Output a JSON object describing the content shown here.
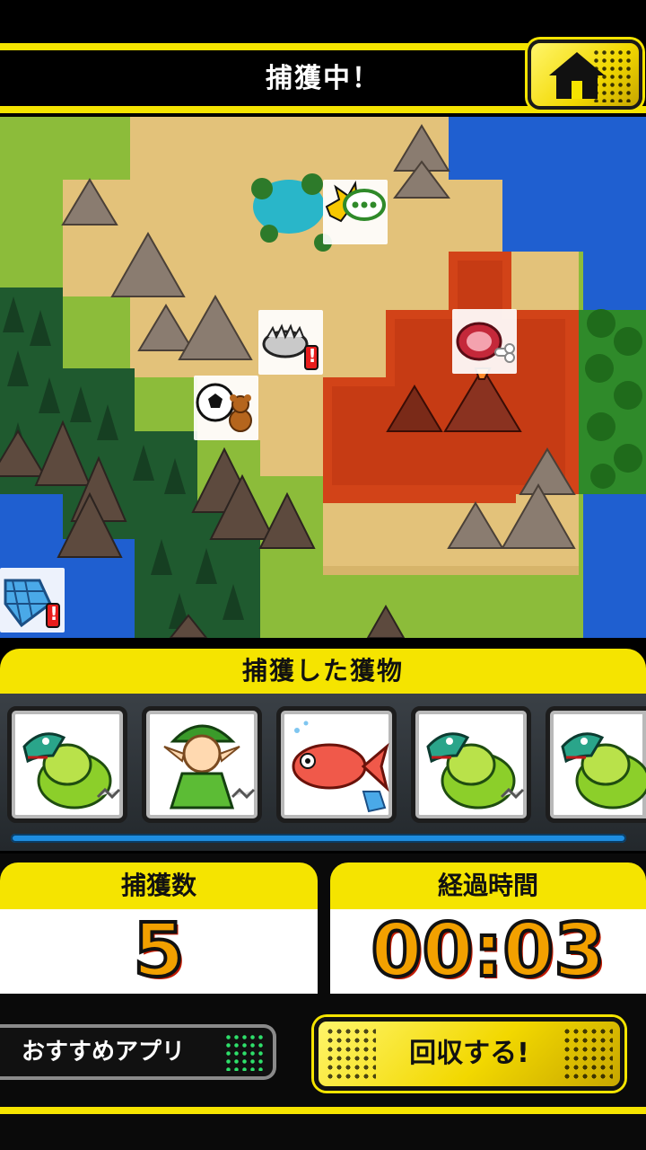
{
  "header": {
    "title": "捕獲中！"
  },
  "caught": {
    "title": "捕獲した獲物"
  },
  "stats": {
    "count_label": "捕獲数",
    "count_value": "5",
    "time_label": "経過時間",
    "time_value": "00:03"
  },
  "buttons": {
    "recommend": "おすすめアプリ",
    "collect": "回収する!"
  },
  "map_markers": {
    "shout_mark": "!",
    "trap_mark": "!",
    "net_mark": "!"
  },
  "colors": {
    "accent_yellow": "#f5e400",
    "number_orange": "#f2a000",
    "scroll_blue": "#1e8de0",
    "lava_red": "#d8401a",
    "sea_blue": "#1f5fd0"
  }
}
